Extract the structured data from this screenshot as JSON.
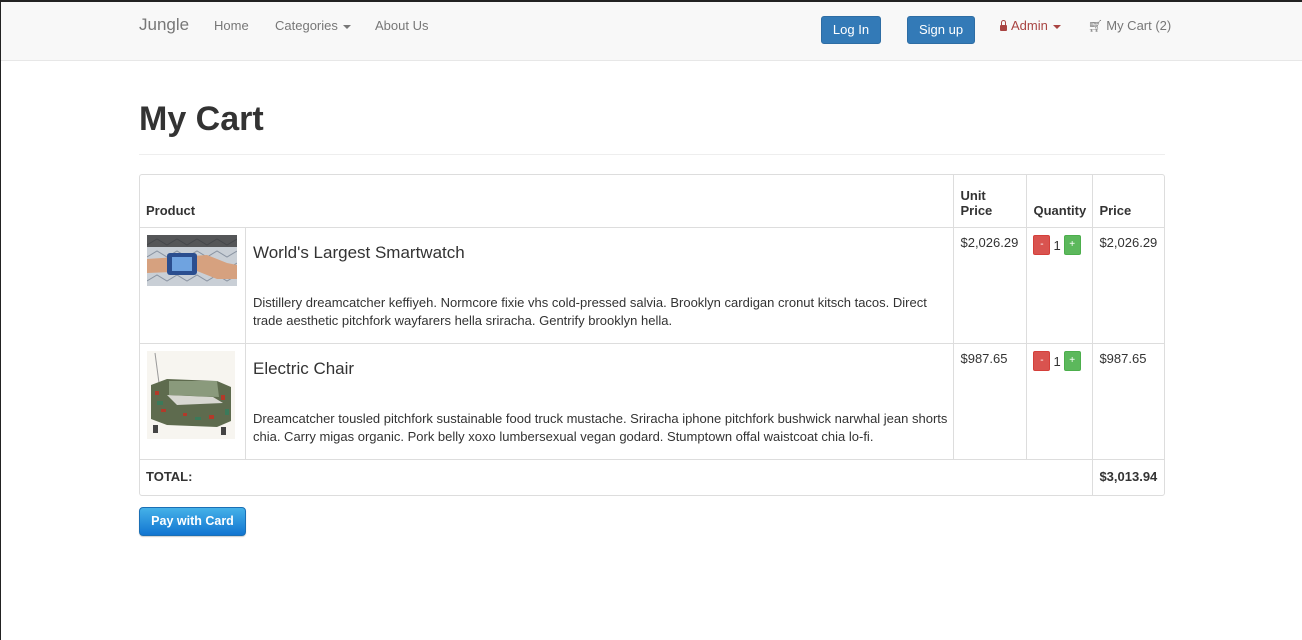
{
  "nav": {
    "brand": "Jungle",
    "home": "Home",
    "categories": "Categories",
    "about": "About Us",
    "login": "Log In",
    "signup": "Sign up",
    "admin": "Admin",
    "cart": "My Cart (2)"
  },
  "page": {
    "title": "My Cart"
  },
  "table": {
    "headers": {
      "product": "Product",
      "unit_price": "Unit Price",
      "quantity": "Quantity",
      "price": "Price"
    },
    "items": [
      {
        "name": "World's Largest Smartwatch",
        "description": "Distillery dreamcatcher keffiyeh. Normcore fixie vhs cold-pressed salvia. Brooklyn cardigan cronut kitsch tacos. Direct trade aesthetic pitchfork wayfarers hella sriracha. Gentrify brooklyn hella.",
        "unit_price": "$2,026.29",
        "quantity": "1",
        "price": "$2,026.29",
        "minus": "-",
        "plus": "+"
      },
      {
        "name": "Electric Chair",
        "description": "Dreamcatcher tousled pitchfork sustainable food truck mustache. Sriracha iphone pitchfork bushwick narwhal jean shorts chia. Carry migas organic. Pork belly xoxo lumbersexual vegan godard. Stumptown offal waistcoat chia lo-fi.",
        "unit_price": "$987.65",
        "quantity": "1",
        "price": "$987.65",
        "minus": "-",
        "plus": "+"
      }
    ],
    "total_label": "TOTAL:",
    "total_value": "$3,013.94"
  },
  "pay_button": "Pay with Card"
}
